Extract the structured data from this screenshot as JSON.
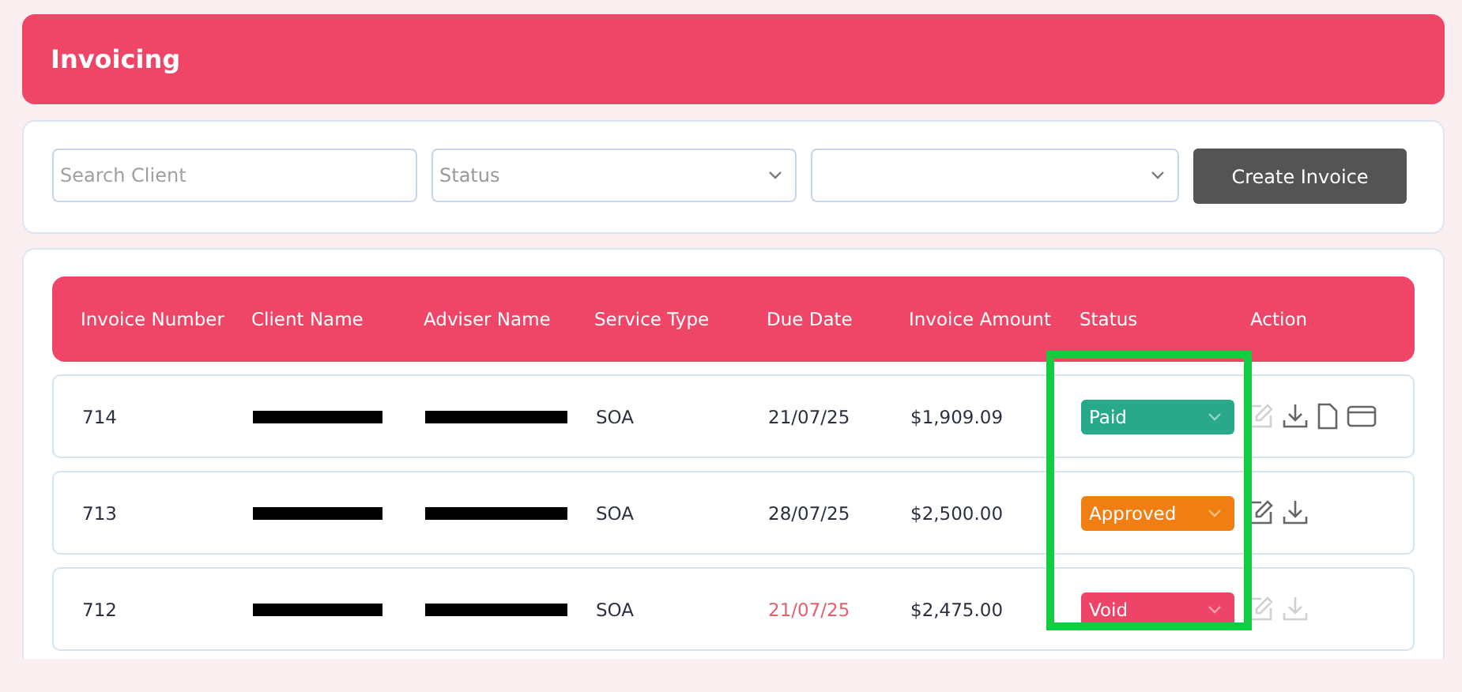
{
  "header": {
    "title": "Invoicing"
  },
  "filters": {
    "search": {
      "placeholder": "Search Client"
    },
    "status": {
      "value": "Status"
    },
    "create_button": "Create Invoice"
  },
  "table": {
    "columns": [
      "Invoice Number",
      "Client Name",
      "Adviser Name",
      "Service Type",
      "Due Date",
      "Invoice Amount",
      "Status",
      "Action"
    ],
    "status_highlight": true,
    "rows": [
      {
        "invoice_number": "714",
        "client_redacted": true,
        "adviser_redacted": true,
        "service_type": "SOA",
        "due_date": "21/07/25",
        "overdue": false,
        "amount": "$1,909.09",
        "status": "Paid",
        "color": "#27a98a",
        "actions": [
          {
            "kind": "edit",
            "disabled": true
          },
          {
            "kind": "download",
            "disabled": false
          },
          {
            "kind": "file",
            "disabled": false
          },
          {
            "kind": "card",
            "disabled": false
          }
        ]
      },
      {
        "invoice_number": "713",
        "client_redacted": true,
        "adviser_redacted": true,
        "service_type": "SOA",
        "due_date": "28/07/25",
        "overdue": false,
        "amount": "$2,500.00",
        "status": "Approved",
        "color": "#f07e12",
        "actions": [
          {
            "kind": "edit",
            "disabled": false
          },
          {
            "kind": "download",
            "disabled": false
          }
        ]
      },
      {
        "invoice_number": "712",
        "client_redacted": true,
        "adviser_redacted": true,
        "service_type": "SOA",
        "due_date": "21/07/25",
        "overdue": true,
        "amount": "$2,475.00",
        "status": "Void",
        "color": "#ee4468",
        "actions": [
          {
            "kind": "edit",
            "disabled": true
          },
          {
            "kind": "download",
            "disabled": true
          }
        ]
      }
    ]
  }
}
